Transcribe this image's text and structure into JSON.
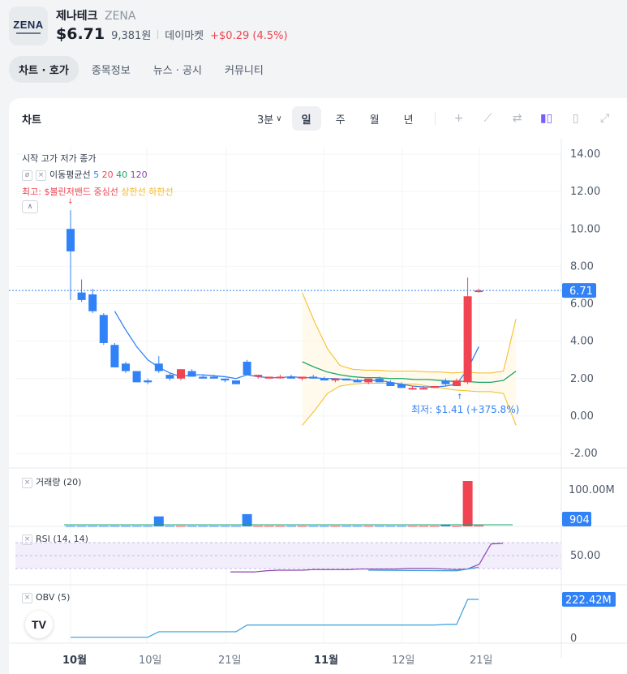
{
  "stock": {
    "name_kr": "제나테크",
    "ticker": "ZENA",
    "logo_text": "ZENA",
    "price_usd": "$6.71",
    "price_krw": "9,381원",
    "market": "데이마켓",
    "change": "+$0.29 (4.5%)"
  },
  "tabs": [
    "차트 · 호가",
    "종목정보",
    "뉴스 · 공시",
    "커뮤니티"
  ],
  "chart_panel": {
    "title": "차트",
    "interval": "3분",
    "periods": [
      "일",
      "주",
      "월",
      "년"
    ],
    "active_period": "일"
  },
  "legends": {
    "ohlc": "시작 고가 저가 종가",
    "ma_label": "이동평균선",
    "ma_periods": [
      "5",
      "20",
      "40",
      "120"
    ],
    "bb_overlap": "최고: $볼린저밴드 중심선",
    "bb_upper": "상한선",
    "bb_lower": "하한선",
    "volume": "거래량 (20)",
    "rsi": "RSI (14, 14)",
    "obv": "OBV (5)"
  },
  "annotations": {
    "low": "최저: $1.41 (+375.8%)"
  },
  "axis": {
    "price_ticks": [
      "14.00",
      "12.00",
      "10.00",
      "8.00",
      "6.00",
      "4.00",
      "2.00",
      "0.00",
      "-2.00"
    ],
    "price_badge": "6.71",
    "volume_tick": "100.00M",
    "volume_badge": "904",
    "rsi_tick": "50.00",
    "obv_badge": "222.42M",
    "obv_tick": "0",
    "x_labels": [
      "10월",
      "10일",
      "21일",
      "11월",
      "12일",
      "21일"
    ]
  },
  "colors": {
    "up": "#f04452",
    "down": "#3182f6",
    "ma5": "#3182f6",
    "ma20": "#f04452",
    "ma40": "#1aa56b",
    "ma120": "#8e44ad",
    "bollinger": "#f5b91e",
    "rsi": "#8e44ad",
    "obv": "#3a9ee0"
  },
  "chart_data": {
    "type": "candlestick",
    "x_axis": [
      "10월",
      "10일",
      "21일",
      "11월",
      "12일",
      "21일"
    ],
    "ylim": [
      -2,
      14
    ],
    "candles": [
      {
        "o": 10.0,
        "h": 11.0,
        "l": 6.2,
        "c": 8.8
      },
      {
        "o": 6.6,
        "h": 7.3,
        "l": 6.1,
        "c": 6.2
      },
      {
        "o": 6.5,
        "h": 6.8,
        "l": 5.5,
        "c": 5.6
      },
      {
        "o": 5.4,
        "h": 5.5,
        "l": 3.8,
        "c": 3.9
      },
      {
        "o": 3.8,
        "h": 3.9,
        "l": 2.6,
        "c": 2.6
      },
      {
        "o": 2.8,
        "h": 2.9,
        "l": 2.3,
        "c": 2.4
      },
      {
        "o": 2.4,
        "h": 2.4,
        "l": 1.8,
        "c": 1.8
      },
      {
        "o": 1.9,
        "h": 2.0,
        "l": 1.7,
        "c": 1.8
      },
      {
        "o": 2.8,
        "h": 3.2,
        "l": 2.3,
        "c": 2.4
      },
      {
        "o": 2.2,
        "h": 2.3,
        "l": 1.9,
        "c": 2.0
      },
      {
        "o": 2.0,
        "h": 2.5,
        "l": 1.9,
        "c": 2.5
      },
      {
        "o": 2.4,
        "h": 2.5,
        "l": 2.1,
        "c": 2.1
      },
      {
        "o": 2.1,
        "h": 2.2,
        "l": 2.0,
        "c": 2.0
      },
      {
        "o": 2.1,
        "h": 2.2,
        "l": 2.0,
        "c": 2.0
      },
      {
        "o": 2.0,
        "h": 2.0,
        "l": 1.8,
        "c": 1.9
      },
      {
        "o": 1.9,
        "h": 1.9,
        "l": 1.7,
        "c": 1.7
      },
      {
        "o": 2.9,
        "h": 3.0,
        "l": 2.2,
        "c": 2.2
      },
      {
        "o": 2.1,
        "h": 2.2,
        "l": 2.0,
        "c": 2.2
      },
      {
        "o": 2.0,
        "h": 2.1,
        "l": 2.0,
        "c": 2.1
      },
      {
        "o": 2.1,
        "h": 2.2,
        "l": 2.0,
        "c": 2.1
      },
      {
        "o": 2.1,
        "h": 2.2,
        "l": 2.0,
        "c": 2.0
      },
      {
        "o": 2.0,
        "h": 2.1,
        "l": 1.9,
        "c": 2.1
      },
      {
        "o": 2.1,
        "h": 2.2,
        "l": 2.0,
        "c": 2.0
      },
      {
        "o": 2.0,
        "h": 2.1,
        "l": 1.9,
        "c": 1.9
      },
      {
        "o": 1.9,
        "h": 2.0,
        "l": 1.8,
        "c": 2.0
      },
      {
        "o": 2.0,
        "h": 2.0,
        "l": 1.9,
        "c": 1.9
      },
      {
        "o": 1.9,
        "h": 2.0,
        "l": 1.8,
        "c": 1.8
      },
      {
        "o": 1.8,
        "h": 2.0,
        "l": 1.7,
        "c": 2.0
      },
      {
        "o": 2.0,
        "h": 2.1,
        "l": 1.8,
        "c": 1.8
      },
      {
        "o": 1.8,
        "h": 1.9,
        "l": 1.6,
        "c": 1.6
      },
      {
        "o": 1.7,
        "h": 1.8,
        "l": 1.5,
        "c": 1.5
      },
      {
        "o": 1.5,
        "h": 1.6,
        "l": 1.4,
        "c": 1.5
      },
      {
        "o": 1.5,
        "h": 1.6,
        "l": 1.41,
        "c": 1.5
      },
      {
        "o": 1.5,
        "h": 1.6,
        "l": 1.5,
        "c": 1.6
      },
      {
        "o": 1.9,
        "h": 2.0,
        "l": 1.6,
        "c": 1.7
      },
      {
        "o": 1.6,
        "h": 2.0,
        "l": 1.6,
        "c": 1.9
      },
      {
        "o": 1.8,
        "h": 7.4,
        "l": 1.7,
        "c": 6.4
      },
      {
        "o": 6.7,
        "h": 6.8,
        "l": 6.6,
        "c": 6.71
      }
    ],
    "volume_values": [
      1,
      1,
      1,
      1,
      1,
      1,
      1,
      1,
      22,
      1,
      1,
      1,
      1,
      1,
      1,
      1,
      27,
      1,
      1,
      1,
      1,
      1,
      1,
      1,
      1,
      1,
      1,
      1,
      1,
      1,
      1,
      1,
      1,
      1,
      3,
      1,
      100,
      2
    ],
    "rsi_values": [
      22,
      22,
      22,
      24,
      25,
      25,
      25,
      26,
      26,
      26,
      26,
      27,
      27,
      27,
      27,
      28,
      28,
      28,
      27,
      26,
      27,
      35,
      70,
      71
    ],
    "obv_values": [
      1,
      1,
      1,
      1,
      1,
      1,
      1,
      1,
      23,
      23,
      23,
      23,
      23,
      23,
      23,
      23,
      50,
      50,
      50,
      50,
      50,
      50,
      50,
      50,
      50,
      50,
      50,
      50,
      50,
      50,
      50,
      50,
      50,
      50,
      53,
      53,
      153,
      153
    ]
  }
}
